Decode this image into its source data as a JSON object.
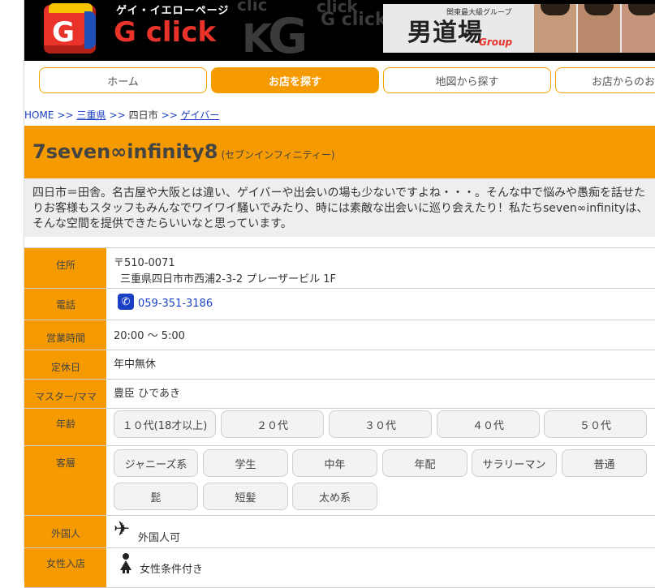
{
  "header": {
    "brand_sub": "ゲイ・イエローページ",
    "brand_main": "G click",
    "logo_letter": "G",
    "ad_tag": "関東最大級グループ",
    "ad_title": "男道場",
    "ad_script": "Group"
  },
  "nav": {
    "tabs": [
      {
        "label": "ホーム",
        "active": false
      },
      {
        "label": "お店を探す",
        "active": true
      },
      {
        "label": "地図から探す",
        "active": false
      },
      {
        "label": "お店からのお",
        "active": false
      }
    ]
  },
  "breadcrumb": {
    "home": "HOME",
    "sep": ">>",
    "pref": "三重県",
    "city": "四日市",
    "category": "ゲイバー"
  },
  "shop": {
    "name": "7seven∞infinity8",
    "kana": "(セブンインフィニティー)",
    "description": "四日市＝田舎。名古屋や大阪とは違い、ゲイバーや出会いの場も少ないですよね・・・。そんな中で悩みや愚痴を話せたりお客様もスタッフもみんなでワイワイ騒いでみたり、時には素敵な出会いに巡り会えたり！私たちseven∞infinityは、そんな空間を提供できたらいいなと思っています。"
  },
  "info": {
    "address_label": "住所",
    "postal": "〒510-0071",
    "address": "三重県四日市市西浦2-3-2 プレーザービル 1F",
    "phone_label": "電話",
    "phone": "059-351-3186",
    "hours_label": "営業時間",
    "hours": "20:00 ～ 5:00",
    "holiday_label": "定休日",
    "holiday": "年中無休",
    "master_label": "マスター/ママ",
    "master": "豊臣 ひであき",
    "age_label": "年齢",
    "ages": [
      "１０代(18才以上)",
      "２０代",
      "３０代",
      "４０代",
      "５０代"
    ],
    "type_label": "客層",
    "types": [
      "ジャニーズ系",
      "学生",
      "中年",
      "年配",
      "サラリーマン",
      "普通",
      "髭",
      "短髪",
      "太め系"
    ],
    "foreigner_label": "外国人",
    "foreigner": "外国人可",
    "women_label": "女性入店",
    "women": "女性条件付き"
  },
  "colors": {
    "accent": "#f59a00",
    "link": "#1a3fc4",
    "brand_red": "#e8322a"
  }
}
